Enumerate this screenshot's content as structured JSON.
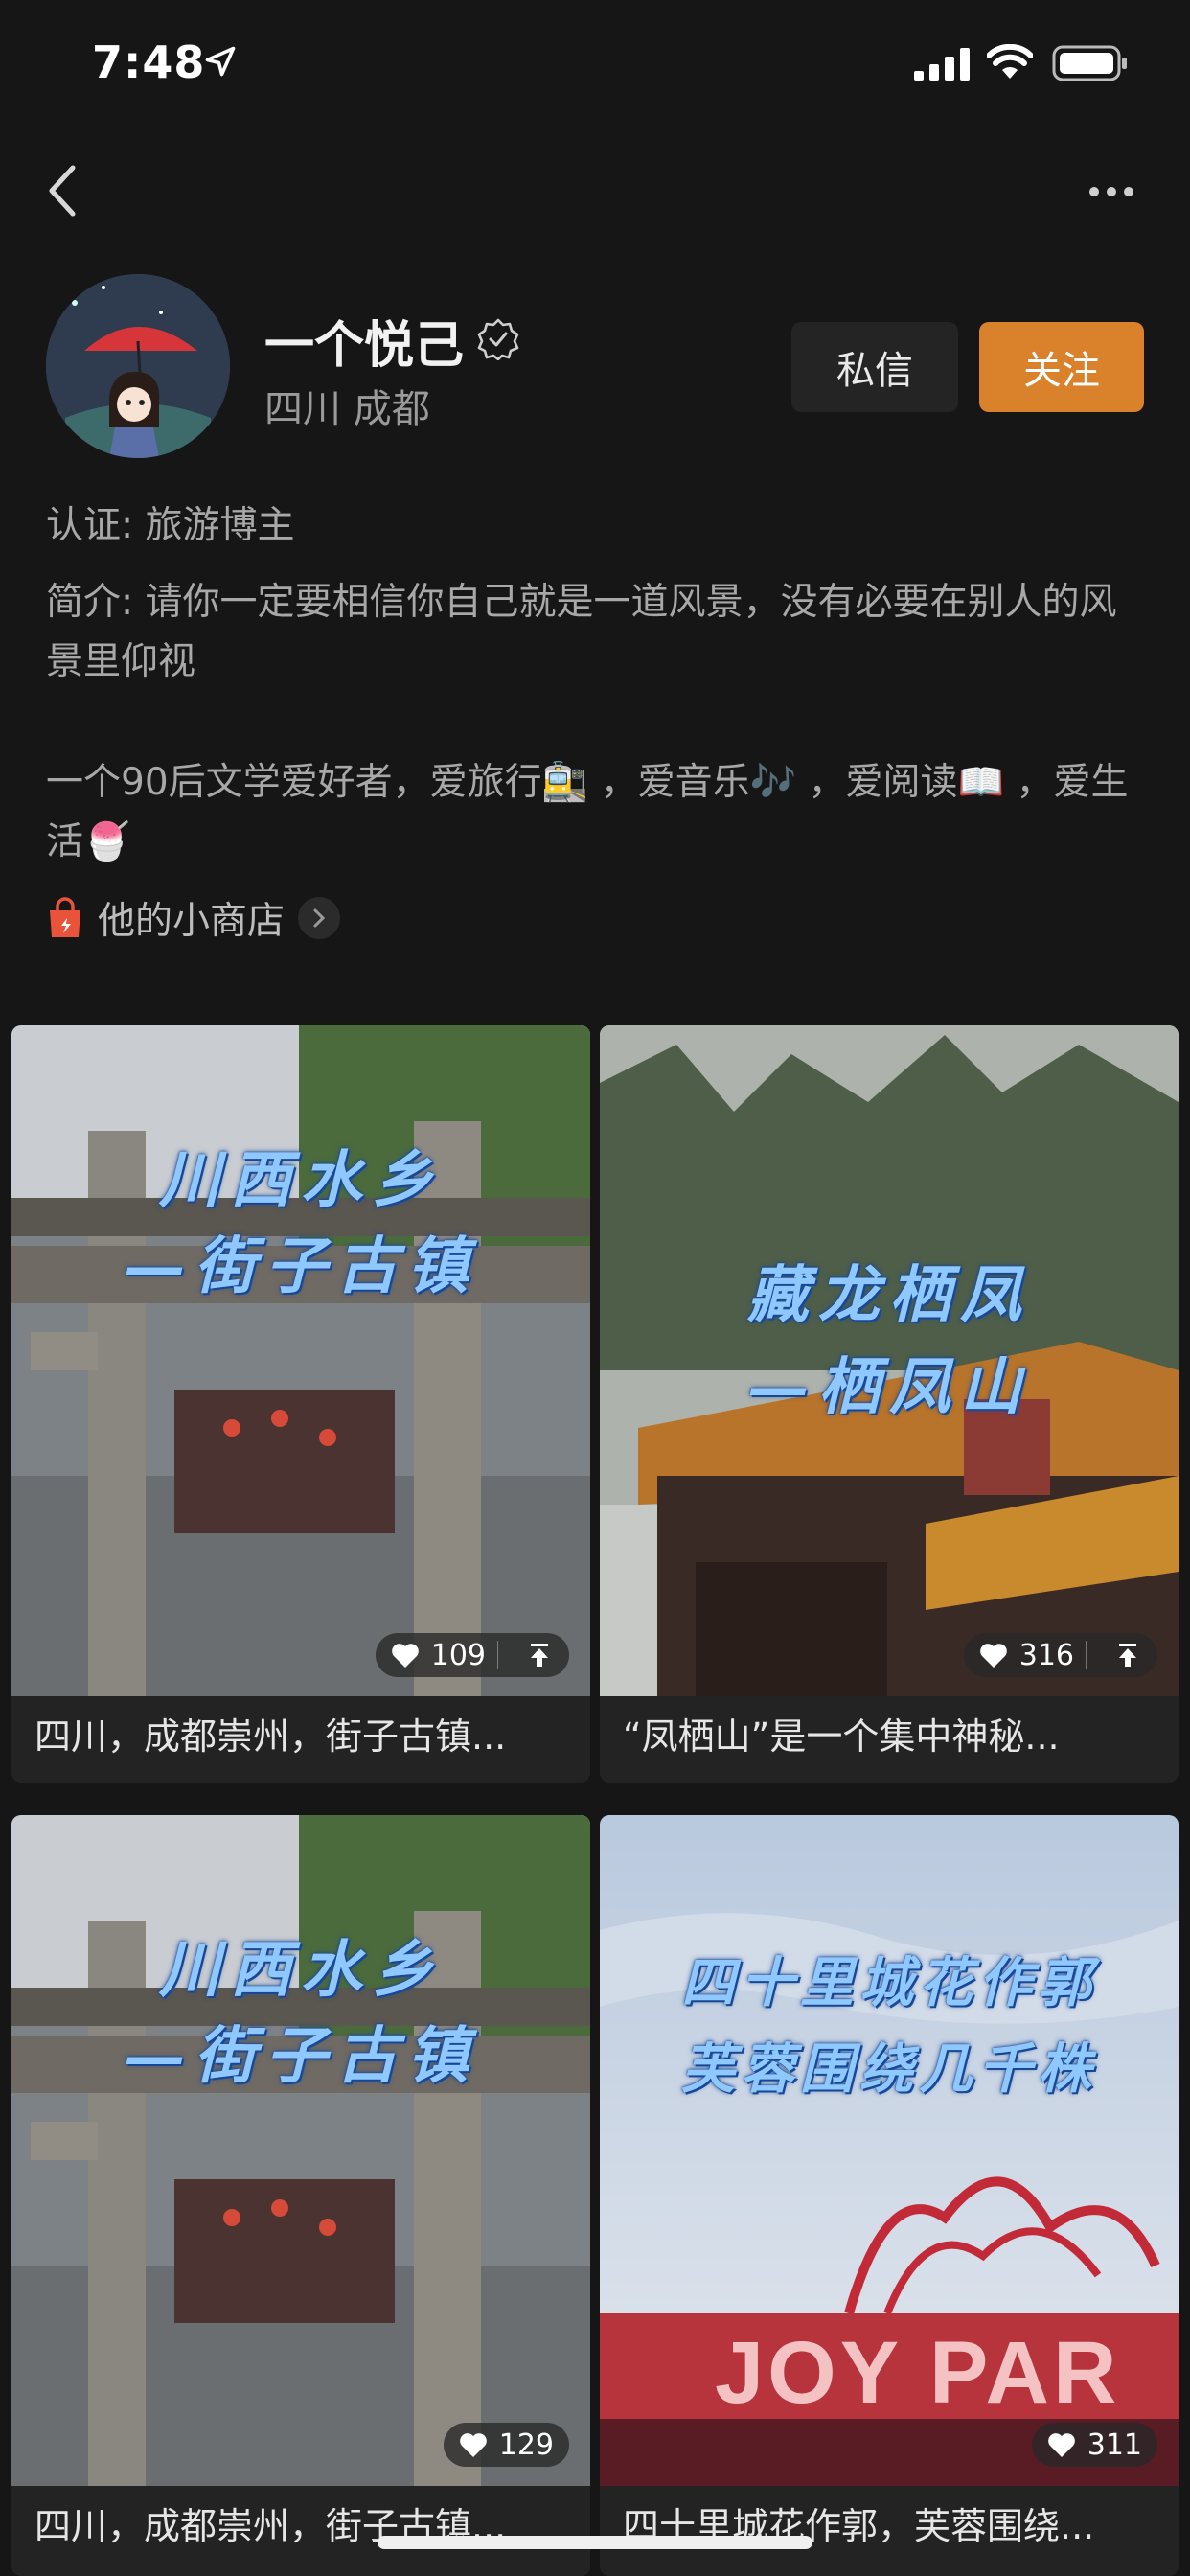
{
  "status_bar": {
    "time": "7:48"
  },
  "profile": {
    "name": "一个悦己",
    "location": "四川 成都",
    "message_label": "私信",
    "follow_label": "关注"
  },
  "bio": {
    "certification": "认证: 旅游博主",
    "intro": "简介: 请你一定要相信你自己就是一道风景，没有必要在别人的风景里仰视",
    "hobbies": "一个90后文学爱好者，爱旅行🚉 ，爱音乐🎶 ，爱阅读📖 ，爱生活🍧",
    "shop_label": "他的小商店"
  },
  "posts": [
    {
      "overlay_line1": "川西水乡",
      "overlay_line2": "—街子古镇",
      "likes": "109",
      "caption": "四川，成都崇州，街子古镇..."
    },
    {
      "overlay_line1": "藏龙栖凤",
      "overlay_line2": "—栖凤山",
      "likes": "316",
      "caption": "“凤栖山”是一个集中神秘..."
    },
    {
      "overlay_line1": "川西水乡",
      "overlay_line2": "—街子古镇",
      "likes": "129",
      "caption": "四川，成都崇州，街子古镇..."
    },
    {
      "overlay_line1": "四十里城花作郭",
      "overlay_line2": "芙蓉围绕几千株",
      "likes": "311",
      "caption": "四十里城花作郭，芙蓉围绕...",
      "sign_text": "JOY PAR"
    }
  ],
  "colors": {
    "background": "#161616",
    "accent": "#d9822b",
    "overlay_text": "#8fc8ff"
  }
}
